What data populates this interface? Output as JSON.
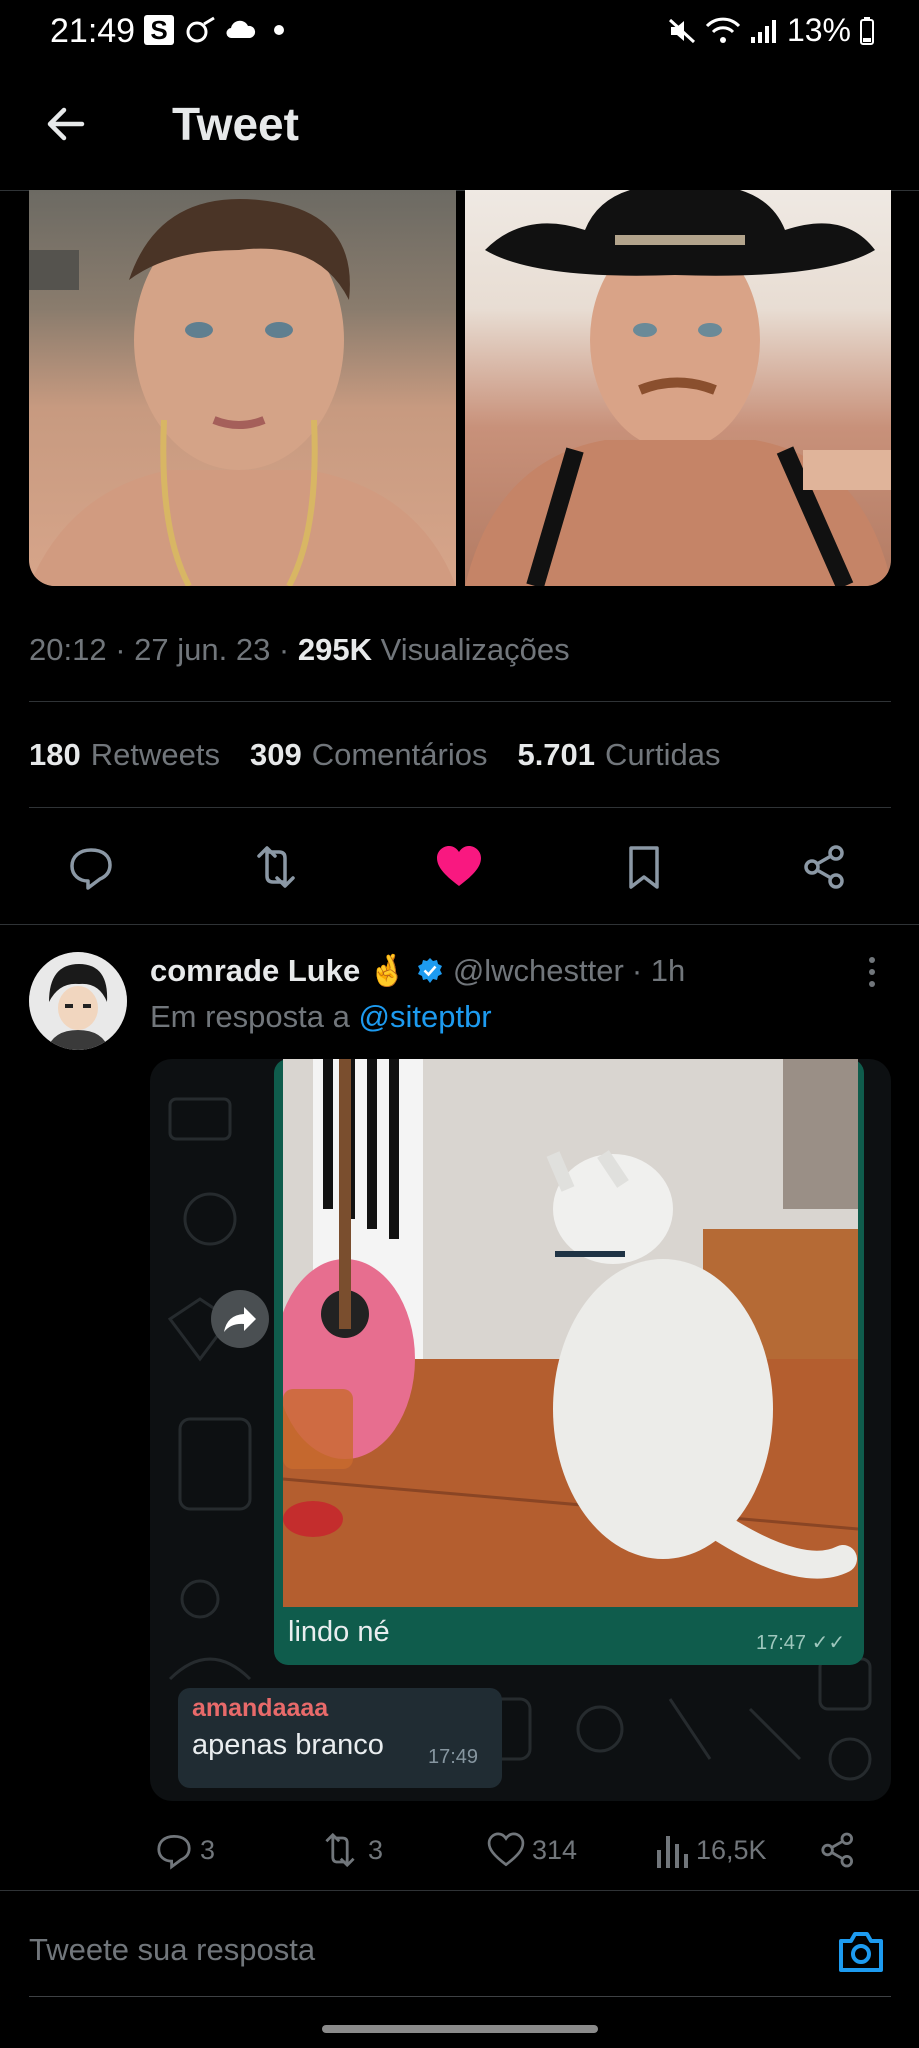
{
  "status": {
    "time": "21:49",
    "s_badge": "S",
    "battery": "13%"
  },
  "header": {
    "title": "Tweet"
  },
  "tweet": {
    "time": "20:12",
    "date": "27 jun. 23",
    "views_count": "295K",
    "views_label": "Visualizações",
    "retweets_count": "180",
    "retweets_label": "Retweets",
    "comments_count": "309",
    "comments_label": "Comentários",
    "likes_count": "5.701",
    "likes_label": "Curtidas",
    "like_color": "#f91880"
  },
  "reply": {
    "name": "comrade Luke",
    "emoji": "🤞",
    "handle": "@lwchestter",
    "age": "· 1h",
    "reply_prefix": "Em resposta a",
    "reply_to": "@siteptbr",
    "chat": {
      "out_text": "lindo né",
      "out_time": "17:47",
      "in_name": "amandaaaa",
      "in_text": "apenas branco",
      "in_time": "17:49"
    },
    "actions": {
      "comments": "3",
      "retweets": "3",
      "likes": "314",
      "views": "16,5K"
    }
  },
  "compose": {
    "placeholder": "Tweete sua resposta",
    "accent": "#1d9bf0"
  }
}
